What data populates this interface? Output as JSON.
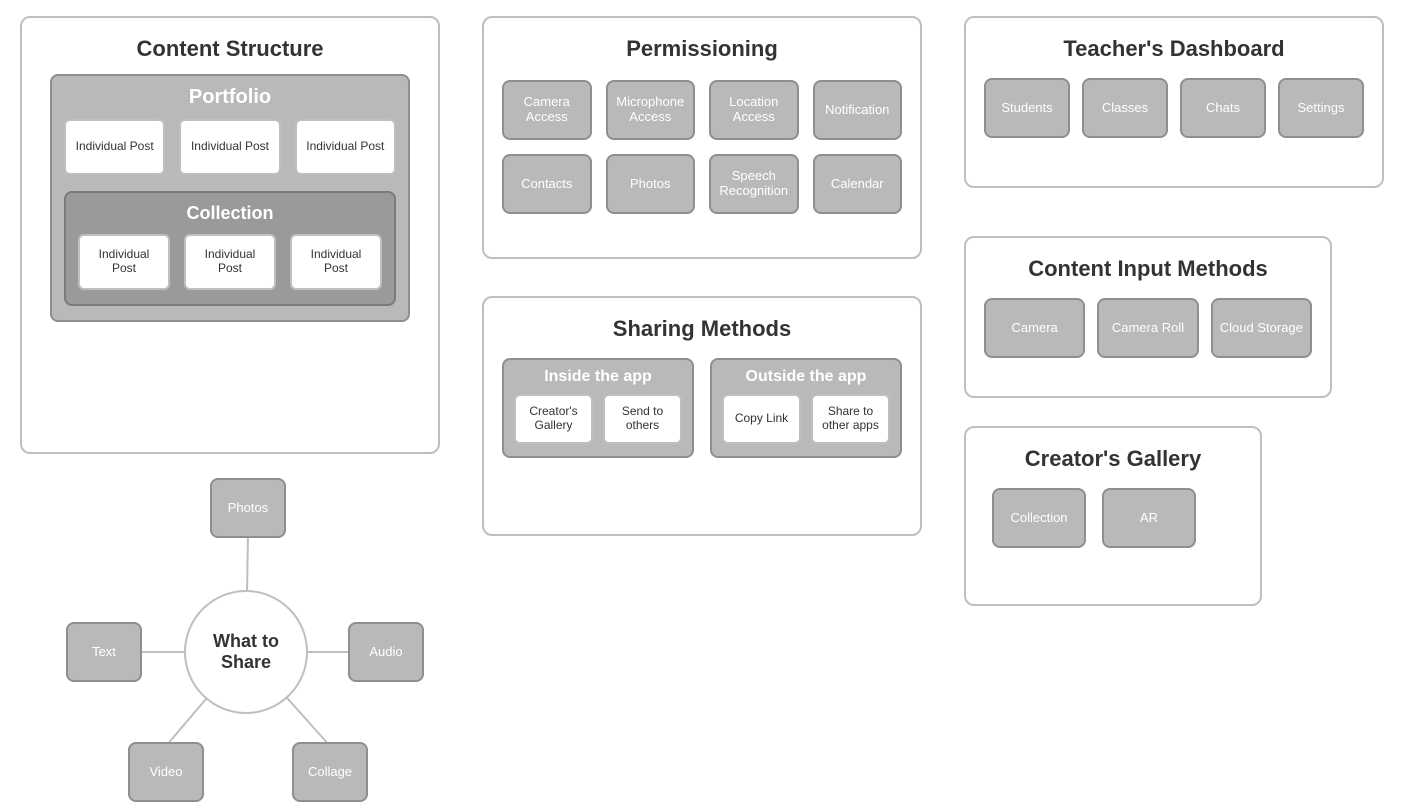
{
  "content_structure": {
    "title": "Content Structure",
    "portfolio": {
      "title": "Portfolio",
      "posts": [
        "Individual Post",
        "Individual Post",
        "Individual Post"
      ],
      "collection": {
        "title": "Collection",
        "posts": [
          "Individual Post",
          "Individual Post",
          "Individual Post"
        ]
      }
    }
  },
  "permissioning": {
    "title": "Permissioning",
    "items": [
      "Camera Access",
      "Microphone Access",
      "Location Access",
      "Notification",
      "Contacts",
      "Photos",
      "Speech Recognition",
      "Calendar"
    ]
  },
  "teachers_dashboard": {
    "title": "Teacher's Dashboard",
    "items": [
      "Students",
      "Classes",
      "Chats",
      "Settings"
    ]
  },
  "sharing_methods": {
    "title": "Sharing Methods",
    "inside": {
      "title": "Inside the app",
      "items": [
        "Creator's Gallery",
        "Send to others"
      ]
    },
    "outside": {
      "title": "Outside the app",
      "items": [
        "Copy Link",
        "Share to other apps"
      ]
    }
  },
  "content_input": {
    "title": "Content Input Methods",
    "items": [
      "Camera",
      "Camera Roll",
      "Cloud Storage"
    ]
  },
  "creators_gallery": {
    "title": "Creator's Gallery",
    "items": [
      "Collection",
      "AR"
    ]
  },
  "what_to_share": {
    "center": "What to Share",
    "nodes": {
      "photos": "Photos",
      "text": "Text",
      "audio": "Audio",
      "video": "Video",
      "collage": "Collage"
    }
  }
}
